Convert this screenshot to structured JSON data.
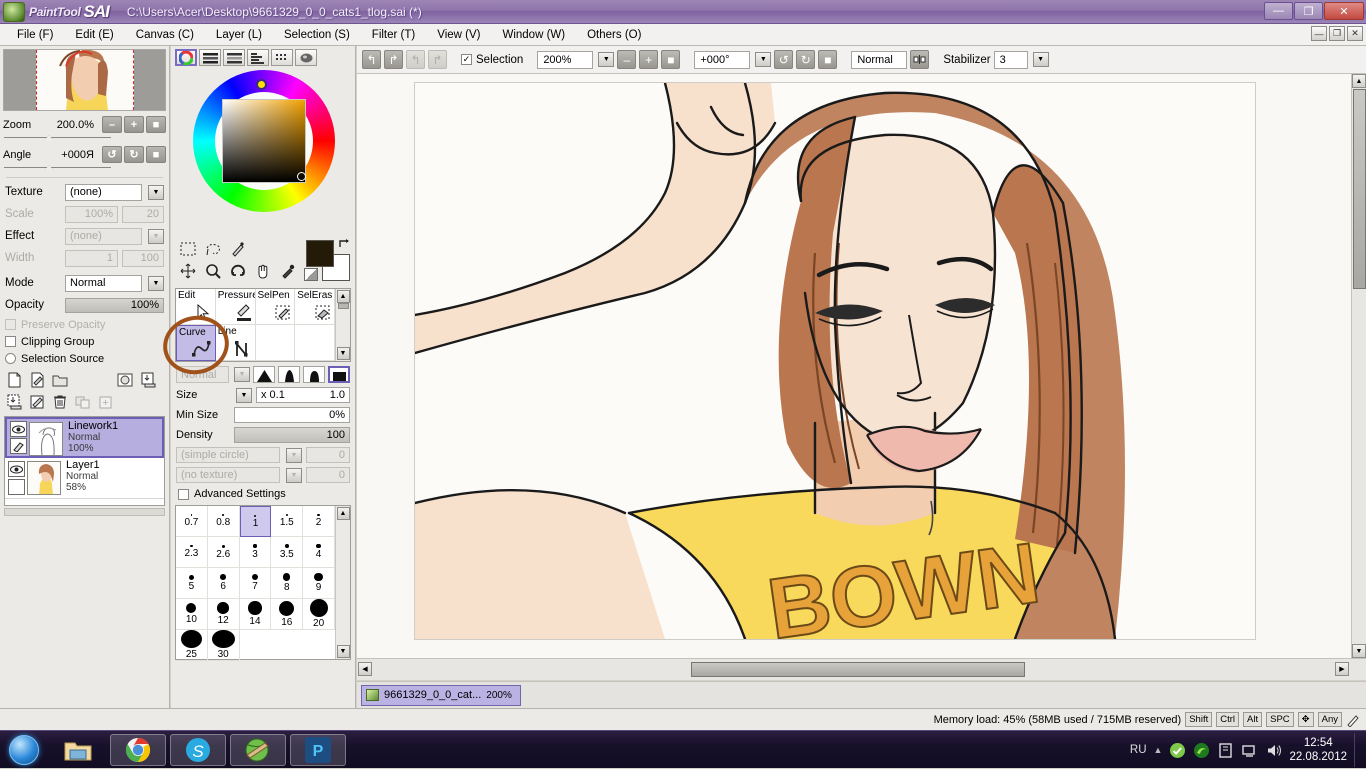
{
  "titlebar": {
    "app_word": "PaintTool",
    "app_name": "SAI",
    "path": "C:\\Users\\Acer\\Desktop\\9661329_0_0_cats1_tlog.sai (*)",
    "minimize": "—",
    "maximize": "❐",
    "close": "✕"
  },
  "menubar": {
    "items": [
      {
        "label": "File (F)"
      },
      {
        "label": "Edit (E)"
      },
      {
        "label": "Canvas (C)"
      },
      {
        "label": "Layer (L)"
      },
      {
        "label": "Selection (S)"
      },
      {
        "label": "Filter (T)"
      },
      {
        "label": "View (V)"
      },
      {
        "label": "Window (W)"
      },
      {
        "label": "Others (O)"
      }
    ],
    "min": "—",
    "max": "❐",
    "close": "✕"
  },
  "navigator": {
    "zoom_label": "Zoom",
    "zoom_value": "200.0%",
    "angle_label": "Angle",
    "angle_value": "+000Я",
    "zoom_out": "–",
    "zoom_in": "+",
    "zoom_reset": "■",
    "rot_left": "↺",
    "rot_right": "↻",
    "rot_reset": "■"
  },
  "layerpanel": {
    "texture_label": "Texture",
    "texture_value": "(none)",
    "scale_label": "Scale",
    "scale_value": "100%",
    "scale_num": "20",
    "effect_label": "Effect",
    "effect_value": "(none)",
    "width_label": "Width",
    "width_value": "1",
    "width_num": "100",
    "mode_label": "Mode",
    "mode_value": "Normal",
    "opacity_label": "Opacity",
    "opacity_value": "100%",
    "preserve_opacity": "Preserve Opacity",
    "clipping_group": "Clipping Group",
    "selection_source": "Selection Source",
    "layers": [
      {
        "name": "Linework1",
        "mode": "Normal",
        "opacity": "100%",
        "selected": true
      },
      {
        "name": "Layer1",
        "mode": "Normal",
        "opacity": "58%",
        "selected": false
      }
    ]
  },
  "colorpanel": {
    "modes": [
      "wheel-icon",
      "rgb-slider-icon",
      "hsv-slider-icon",
      "gradient-icon",
      "mixer-icon",
      "swatch-icon"
    ],
    "foreground_color": "#231a08",
    "background_color": "#ffffff"
  },
  "tools": {
    "icons_row1": [
      "rect-select-icon",
      "lasso-icon",
      "magic-wand-icon"
    ],
    "icons_row2": [
      "move-icon",
      "zoom-icon",
      "rotate-icon",
      "hand-icon",
      "eyedropper-icon"
    ],
    "list": [
      {
        "label": "Edit",
        "icon": "cursor-icon",
        "selected": false
      },
      {
        "label": "Pressure",
        "icon": "pressure-icon",
        "selected": false
      },
      {
        "label": "SelPen",
        "icon": "selpen-icon",
        "selected": false
      },
      {
        "label": "SelEras",
        "icon": "seleras-icon",
        "selected": false
      },
      {
        "label": "Curve",
        "icon": "curve-icon",
        "selected": true
      },
      {
        "label": "Line",
        "icon": "line-icon",
        "selected": false
      }
    ]
  },
  "brush": {
    "blend_mode": "Normal",
    "size_label": "Size",
    "size_mult": "x 0.1",
    "size_value": "1.0",
    "minsize_label": "Min Size",
    "minsize_value": "0%",
    "density_label": "Density",
    "density_value": "100",
    "shape_value": "(simple circle)",
    "shape_num": "0",
    "texture_value": "(no texture)",
    "texture_num": "0",
    "advanced_settings": "Advanced Settings",
    "sizes": [
      {
        "v": "0.7",
        "d": 1.5
      },
      {
        "v": "0.8",
        "d": 1.8
      },
      {
        "v": "1",
        "d": 2,
        "selected": true
      },
      {
        "v": "1.5",
        "d": 2.3
      },
      {
        "v": "2",
        "d": 2.6
      },
      {
        "v": "2.3",
        "d": 2.8
      },
      {
        "v": "2.6",
        "d": 3
      },
      {
        "v": "3",
        "d": 3.4
      },
      {
        "v": "3.5",
        "d": 3.8
      },
      {
        "v": "4",
        "d": 4.2
      },
      {
        "v": "5",
        "d": 5
      },
      {
        "v": "6",
        "d": 5.6
      },
      {
        "v": "7",
        "d": 6.4
      },
      {
        "v": "8",
        "d": 7.4
      },
      {
        "v": "9",
        "d": 8.4
      },
      {
        "v": "10",
        "d": 10
      },
      {
        "v": "12",
        "d": 11.6
      },
      {
        "v": "14",
        "d": 13.4
      },
      {
        "v": "16",
        "d": 15
      },
      {
        "v": "20",
        "d": 18
      },
      {
        "v": "25",
        "d": 21
      },
      {
        "v": "30",
        "d": 23
      }
    ]
  },
  "toolbar": {
    "undo": "↰",
    "redo": "↱",
    "undo2": "↰",
    "redo2": "↱",
    "selection_label": "Selection",
    "zoom_value": "200%",
    "zoom_out": "–",
    "zoom_in": "+",
    "zoom_reset": "■",
    "angle_value": "+000°",
    "rot_left": "↺",
    "rot_right": "↻",
    "rot_reset": "■",
    "blend_mode": "Normal",
    "flip_icon": "flip-icon",
    "stabilizer_label": "Stabilizer",
    "stabilizer_value": "3"
  },
  "tabbar": {
    "doc_name": "9661329_0_0_cat...",
    "doc_zoom": "200%"
  },
  "statusbar": {
    "memory": "Memory load: 45% (58MB used / 715MB reserved)",
    "keys": [
      "Shift",
      "Ctrl",
      "Alt",
      "SPC"
    ],
    "nav": "✥",
    "any": "Any",
    "pen": "pen-icon"
  },
  "taskbar": {
    "start": "start-orb-icon",
    "apps": [
      "explorer-icon",
      "chrome-icon",
      "skype-icon",
      "paint-tool-sai-icon",
      "photoshop-icon"
    ],
    "lang": "RU",
    "tray": [
      "show-hidden-icon",
      "antivirus-icon",
      "nvidia-icon",
      "device-icon",
      "network-icon",
      "volume-icon"
    ],
    "time": "12:54",
    "date": "22.08.2012"
  }
}
